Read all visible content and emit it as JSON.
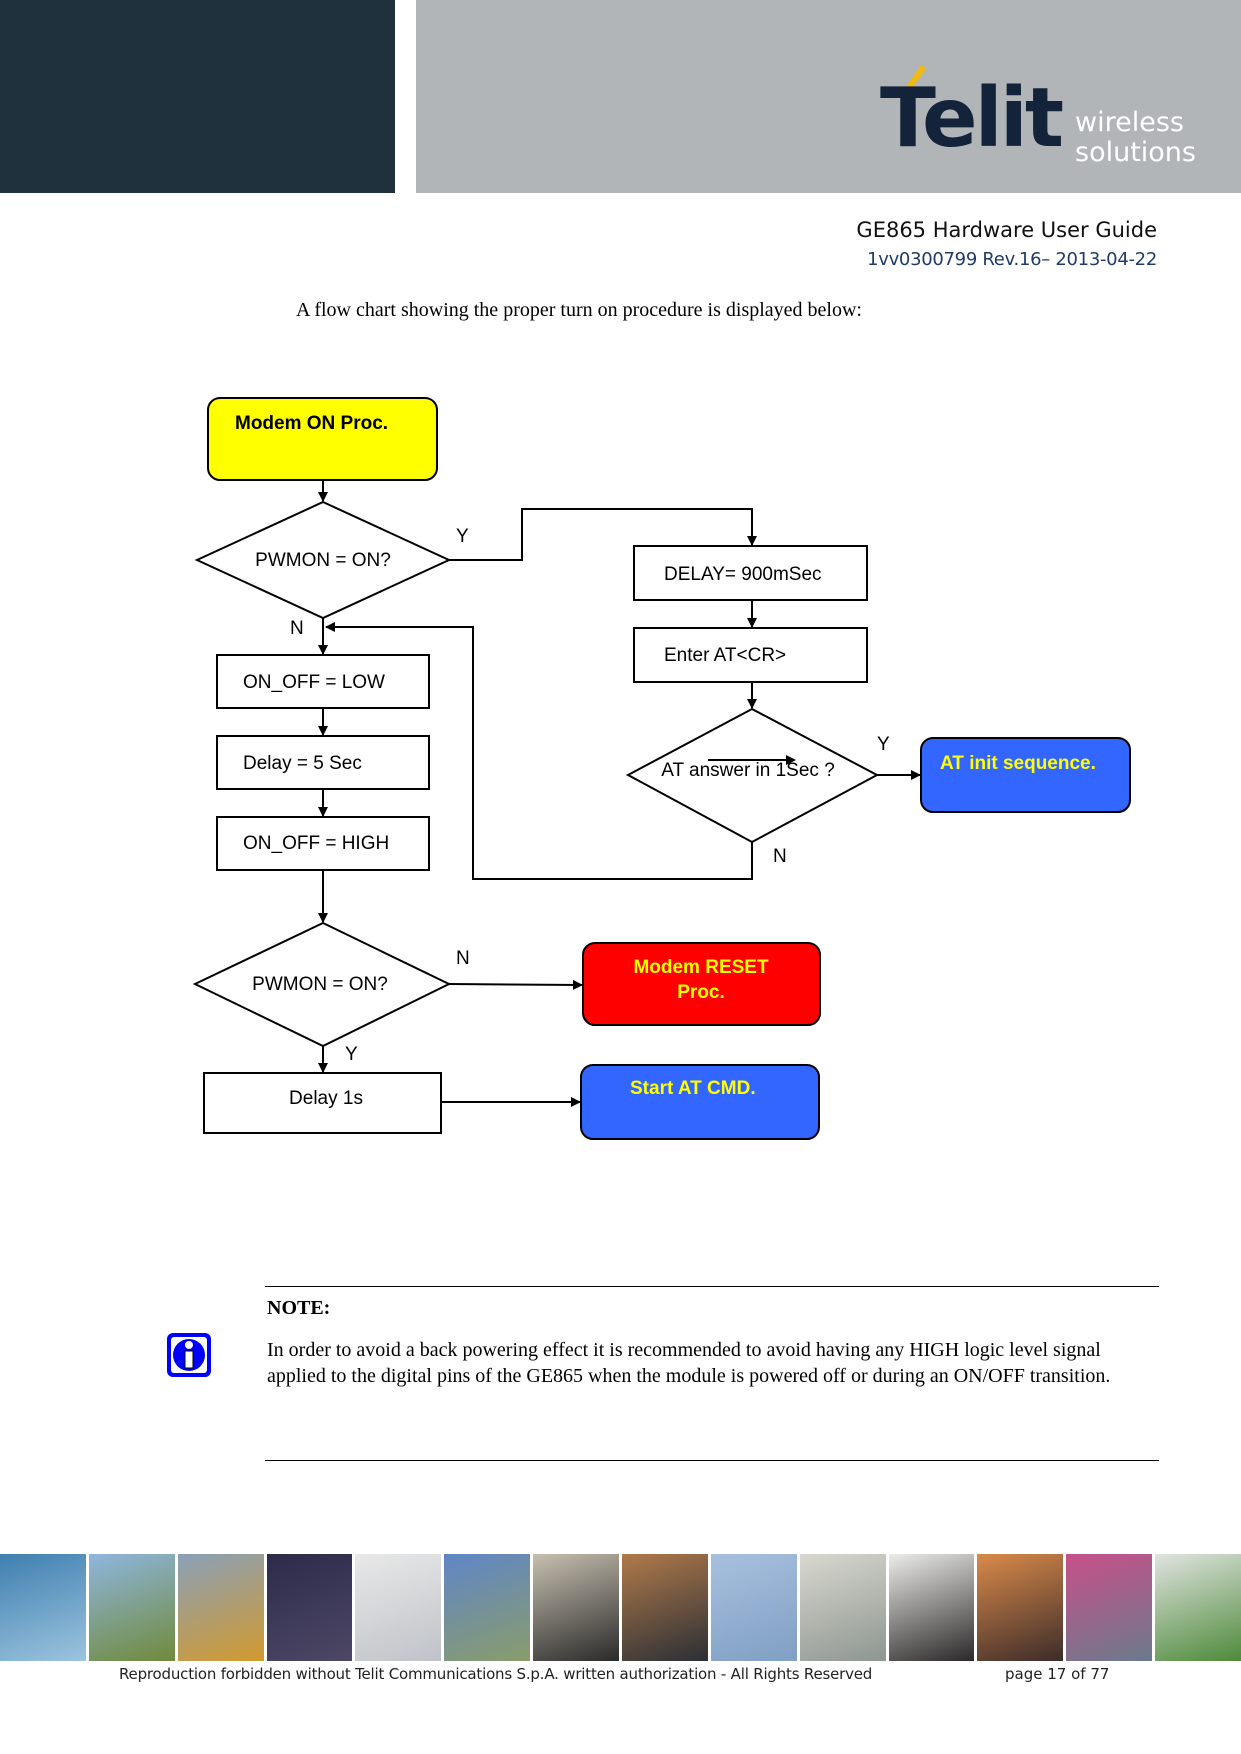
{
  "header": {
    "logo_word": "Telit",
    "logo_tagline_1": "wireless",
    "logo_tagline_2": "solutions",
    "doc_title": "GE865 Hardware User Guide",
    "doc_revision": "1vv0300799 Rev.16– 2013-04-22",
    "colors": {
      "dark_block": "#1e313c",
      "gray_block": "#b2b5b8",
      "accent": "#f2b90f"
    }
  },
  "intro": "A flow chart showing the proper turn on procedure is displayed below:",
  "flowchart": {
    "nodes": {
      "start": "Modem ON Proc.",
      "check_pwmon_1": "PWMON = ON?",
      "on_off_low": "ON_OFF = LOW",
      "delay_5s": "Delay = 5 Sec",
      "on_off_high": "ON_OFF = HIGH",
      "check_pwmon_2": "PWMON = ON?",
      "delay_1s": "Delay 1s",
      "modem_reset": [
        "Modem RESET",
        "Proc."
      ],
      "start_at_cmd": "Start AT CMD.",
      "delay_900": "DELAY= 900mSec",
      "enter_at": "Enter AT<CR>",
      "check_at_answer": "AT answer in 1Sec ?",
      "at_init": "AT init sequence."
    },
    "edge_labels": {
      "pwmon1_yes": "Y",
      "pwmon1_no": "N",
      "at_yes": "Y",
      "at_no": "N",
      "pwmon2_no": "N",
      "pwmon2_yes": "Y"
    },
    "colors": {
      "start_fill": "#ffff00",
      "reset_fill": "#ff0000",
      "blue_fill": "#3366ff",
      "highlight_text": "#ffff00"
    }
  },
  "note": {
    "icon": "info-icon",
    "title": "NOTE:",
    "body": "In order to avoid a back powering effect it is recommended to avoid having any HIGH logic level signal applied to the digital pins of the GE865 when the module is powered off or during an ON/OFF transition."
  },
  "footer": {
    "photos": [
      {
        "name": "traffic",
        "c1": "#3f7fb0",
        "c2": "#9cc4de"
      },
      {
        "name": "sos-phone",
        "c1": "#8fb6df",
        "c2": "#6f8a3a"
      },
      {
        "name": "containers",
        "c1": "#8aa0b8",
        "c2": "#d29a2e"
      },
      {
        "name": "timetable-display",
        "c1": "#2c2b4a",
        "c2": "#4e4766"
      },
      {
        "name": "keyboard",
        "c1": "#e8e8e8",
        "c2": "#bfc3c8"
      },
      {
        "name": "cyclist",
        "c1": "#5f86c8",
        "c2": "#8a9c6a"
      },
      {
        "name": "card-reader",
        "c1": "#c7c0b0",
        "c2": "#2a2a2a"
      },
      {
        "name": "vending",
        "c1": "#b07a4a",
        "c2": "#2b2f36"
      },
      {
        "name": "wind-turbines",
        "c1": "#a8c0de",
        "c2": "#7f9fc4"
      },
      {
        "name": "power-meter",
        "c1": "#d8d8d0",
        "c2": "#8e9690"
      },
      {
        "name": "wall",
        "c1": "#ececea",
        "c2": "#2a2828"
      },
      {
        "name": "train",
        "c1": "#d98a4a",
        "c2": "#3c2c2a"
      },
      {
        "name": "printing",
        "c1": "#c8508a",
        "c2": "#6a7a8c"
      },
      {
        "name": "cctv-camera",
        "c1": "#e0e4e0",
        "c2": "#4e8a3a"
      }
    ],
    "copyright": "Reproduction forbidden without Telit Communications S.p.A. written authorization - All Rights Reserved",
    "page": "page 17 of 77"
  }
}
